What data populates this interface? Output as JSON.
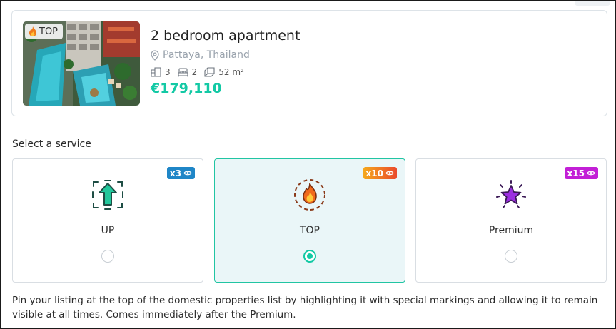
{
  "listing": {
    "tag": "TOP",
    "title": "2 bedroom apartment",
    "location": "Pattaya, Thailand",
    "rooms": "3",
    "bedrooms": "2",
    "area": "52 m²",
    "price": "€179,110"
  },
  "service_section": {
    "label": "Select a service",
    "options": [
      {
        "name": "UP",
        "badge": "x3",
        "badge_color": "#1f86c7",
        "icon": "arrow-up-icon",
        "selected": false
      },
      {
        "name": "TOP",
        "badge": "x10",
        "badge_color": "#f08a1c",
        "icon": "flame-icon",
        "selected": true
      },
      {
        "name": "Premium",
        "badge": "x15",
        "badge_color": "#c21fd6",
        "icon": "star-icon",
        "selected": false
      }
    ]
  },
  "description": "Pin your listing at the top of the domestic properties list by highlighting it with special markings and allowing it to remain visible at all times. Comes immediately after the Premium.",
  "colors": {
    "accent": "#13c9a5",
    "selected_bg": "#eaf6f8",
    "muted": "#9aa3ad"
  }
}
